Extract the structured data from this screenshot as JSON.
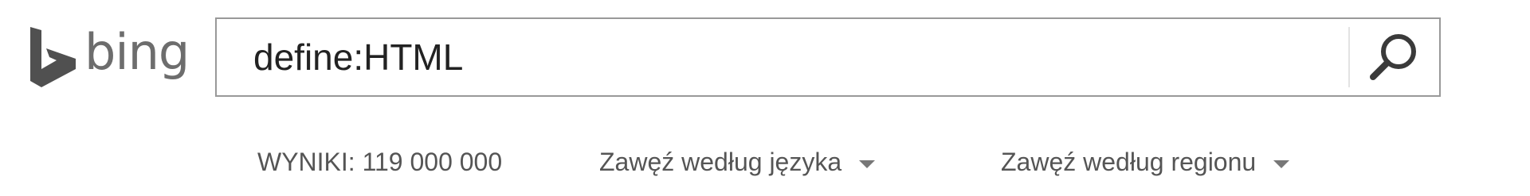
{
  "brand": {
    "name": "bing"
  },
  "search": {
    "query": "define:HTML",
    "button_icon": "search-icon"
  },
  "results": {
    "count_text": "WYNIKI: 119 000 000"
  },
  "filters": {
    "language_label": "Zawęź według języka",
    "region_label": "Zawęź według regionu",
    "caret_icon": "caret-down-icon"
  },
  "colors": {
    "logo_mark": "#505050",
    "logo_text": "#6d6d6d",
    "search_border": "#999999",
    "text_secondary": "#555555"
  }
}
